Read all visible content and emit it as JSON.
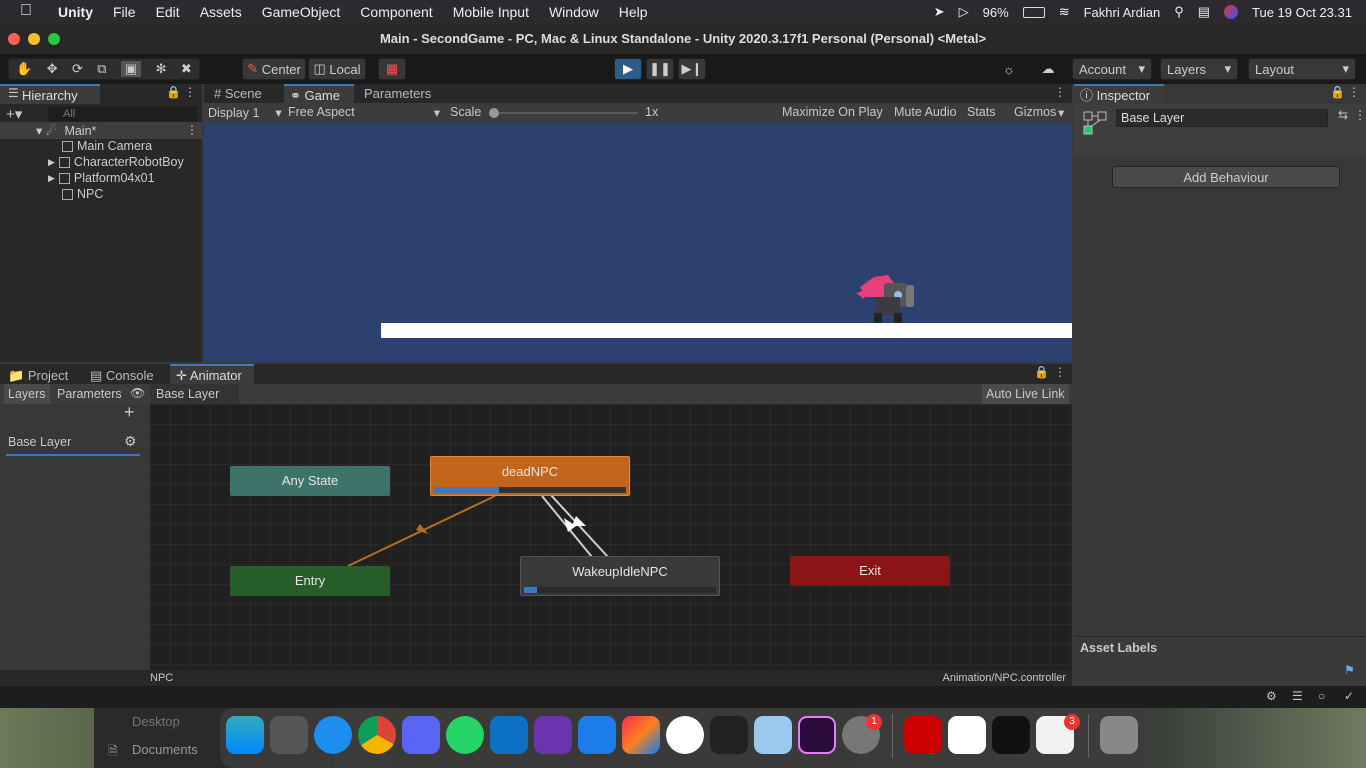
{
  "menubar": {
    "app": "Unity",
    "items": [
      "File",
      "Edit",
      "Assets",
      "GameObject",
      "Component",
      "Mobile Input",
      "Window",
      "Help"
    ],
    "battery": "96%",
    "user": "Fakhri Ardian",
    "datetime": "Tue 19 Oct  23.31"
  },
  "window": {
    "title": "Main - SecondGame - PC, Mac & Linux Standalone - Unity 2020.3.17f1 Personal (Personal) <Metal>"
  },
  "toolbar": {
    "pivot": "Center",
    "space": "Local",
    "account": "Account",
    "layers": "Layers",
    "layout": "Layout"
  },
  "hierarchy": {
    "tab": "Hierarchy",
    "search_placeholder": "All",
    "scene": "Main*",
    "items": [
      "Main Camera",
      "CharacterRobotBoy",
      "Platform04x01",
      "NPC"
    ]
  },
  "gameview": {
    "tabs": [
      "Scene",
      "Game",
      "Parameters"
    ],
    "display": "Display 1",
    "aspect": "Free Aspect",
    "scale_label": "Scale",
    "scale_value": "1x",
    "maximize": "Maximize On Play",
    "mute": "Mute Audio",
    "stats": "Stats",
    "gizmos": "Gizmos",
    "colors": {
      "sky": "#2d4170",
      "platform": "#ffffff"
    }
  },
  "inspector": {
    "tab": "Inspector",
    "name": "Base Layer",
    "add_behaviour": "Add Behaviour",
    "asset_labels": "Asset Labels"
  },
  "bottom": {
    "tabs": [
      "Project",
      "Console",
      "Animator"
    ],
    "layers_tab": "Layers",
    "params_tab": "Parameters",
    "breadcrumb": "Base Layer",
    "auto_live": "Auto Live Link",
    "layer_name": "Base Layer",
    "footer_left": "NPC",
    "footer_right": "Animation/NPC.controller"
  },
  "animator": {
    "nodes": {
      "any": "Any State",
      "entry": "Entry",
      "dead": "deadNPC",
      "wake": "WakeupIdleNPC",
      "exit": "Exit"
    },
    "progress": {
      "dead": 0.34,
      "wake": 0.07
    },
    "colors": {
      "any": "#3d7369",
      "entry": "#275c2b",
      "dead": "#c2641c",
      "wake": "#393939",
      "exit": "#8a1418"
    }
  },
  "finder": {
    "desktop": "Desktop",
    "documents": "Documents"
  },
  "dock": {
    "badges": [
      "1",
      "3"
    ]
  }
}
